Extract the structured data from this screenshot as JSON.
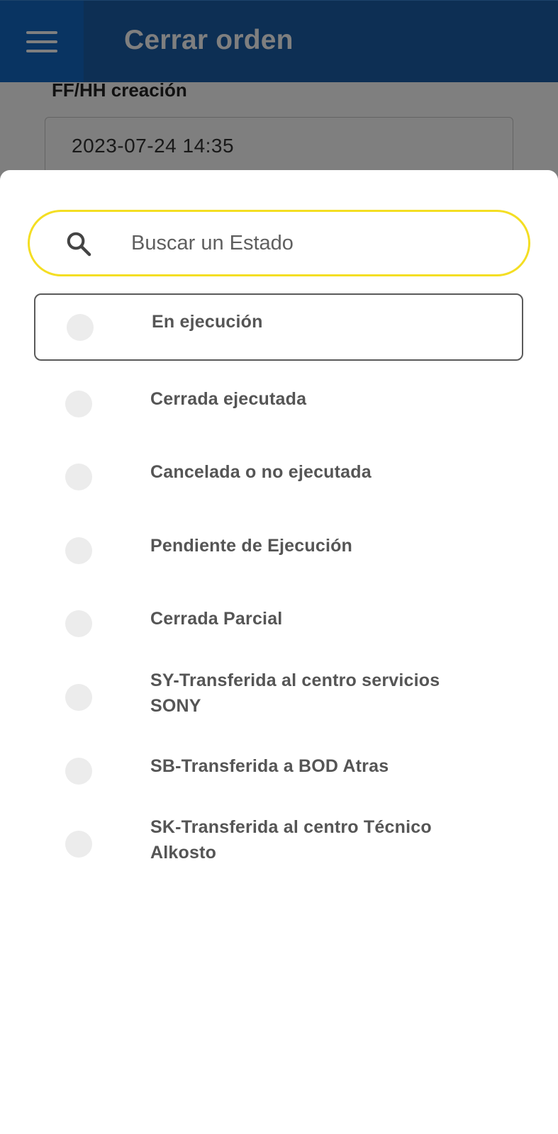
{
  "app_bar": {
    "title": "Cerrar orden",
    "menu_icon": "hamburger-menu-icon"
  },
  "background_form": {
    "field_label": "FF/HH creación",
    "field_value": "2023-07-24 14:35"
  },
  "sheet": {
    "search": {
      "icon": "search-icon",
      "placeholder": "Buscar un Estado",
      "value": "",
      "border_color": "#f4de23"
    },
    "options": [
      {
        "label": "En ejecución",
        "selected": true
      },
      {
        "label": "Cerrada ejecutada",
        "selected": false
      },
      {
        "label": "Cancelada o no ejecutada",
        "selected": false
      },
      {
        "label": "Pendiente de Ejecución",
        "selected": false
      },
      {
        "label": "Cerrada Parcial",
        "selected": false
      },
      {
        "label": "SY-Transferida al centro servicios SONY",
        "selected": false
      },
      {
        "label": "SB-Transferida a BOD Atras",
        "selected": false
      },
      {
        "label": "SK-Transferida al centro Técnico Alkosto",
        "selected": false
      }
    ]
  },
  "colors": {
    "app_bar": "#1a5fa8",
    "menu_button": "#1269c4",
    "search_border": "#f4de23",
    "option_text": "#555555"
  }
}
